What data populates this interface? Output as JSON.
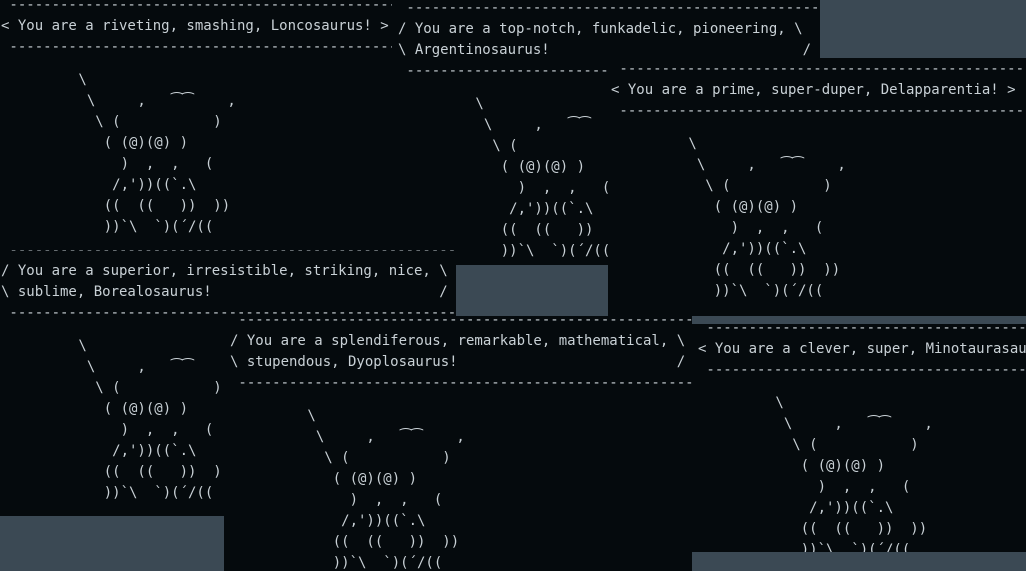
{
  "windows": [
    {
      "speech": [
        " ------------------------------------------------",
        "< You are a riveting, smashing, Loncosaurus! >",
        " ------------------------------------------------"
      ]
    },
    {
      "speech": [
        " -------------------------------------------------",
        "/ You are a top-notch, funkadelic, pioneering, \\",
        "\\ Argentinosaurus!                              /",
        " -------------------------------------------------"
      ]
    },
    {
      "speech": [
        " -------------------------------------------------",
        "< You are a prime, super-duper, Delapparentia! >",
        " -------------------------------------------------"
      ]
    },
    {
      "speech": [
        " -------------------------------------------------------",
        "/ You are a superior, irresistible, striking, nice, \\",
        "\\ sublime, Borealosaurus!                           /",
        " -------------------------------------------------------"
      ]
    },
    {
      "speech": [
        " -------------------------------------------------------",
        "/ You are a splendiferous, remarkable, mathematical, \\",
        "\\ stupendous, Dyoplosaurus!                          /",
        " -------------------------------------------------------"
      ]
    },
    {
      "speech": [
        " -------------------------------------------------",
        "< You are a clever, super, Minotaurasaurus! >",
        " -------------------------------------------------"
      ]
    }
  ],
  "dino_art": [
    "        \\                 ",
    "         \\     ,   ⁀⁀    ,",
    "          \\ (           )",
    "           ( (@)(@) )",
    "             )  ,  ,   (",
    "            /,'))((`.\\",
    "           ((  ((   ))  ))",
    "           ))`\\  `)(´/(("
  ]
}
